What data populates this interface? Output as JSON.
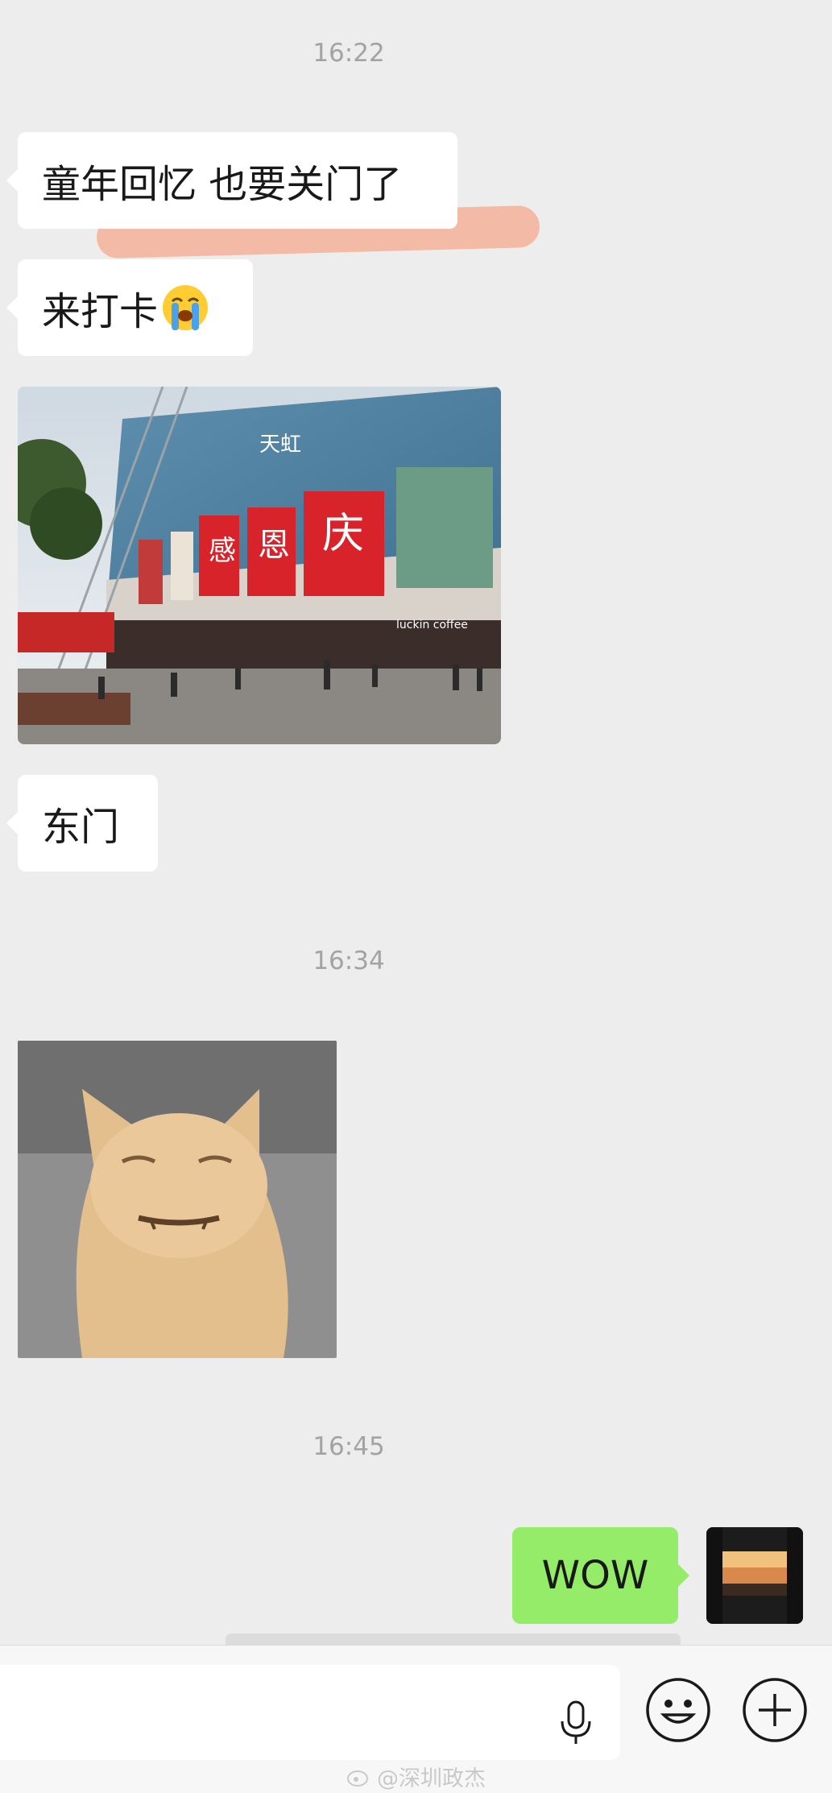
{
  "messages": {
    "time1": "16:22",
    "msg1": "童年回忆 也要关门了",
    "msg2": "来打卡",
    "msg2_emoji": "loudly-crying-face",
    "photo_sign": "天虹",
    "photo_banner": [
      "感",
      "恩",
      "庆"
    ],
    "photo_store": "luckin coffee",
    "msg3": "东门",
    "time2": "16:34",
    "time3": "16:45",
    "msg4": "WOW"
  },
  "input_bar": {
    "mic_icon": "microphone-icon",
    "emoji_icon": "smile-icon",
    "plus_icon": "plus-icon"
  },
  "watermark": "@深圳政杰",
  "colors": {
    "background": "#ededed",
    "bubble_in": "#ffffff",
    "bubble_out": "#95ec69",
    "highlight": "#f4a98c",
    "timestamp": "#a3a3a3"
  }
}
